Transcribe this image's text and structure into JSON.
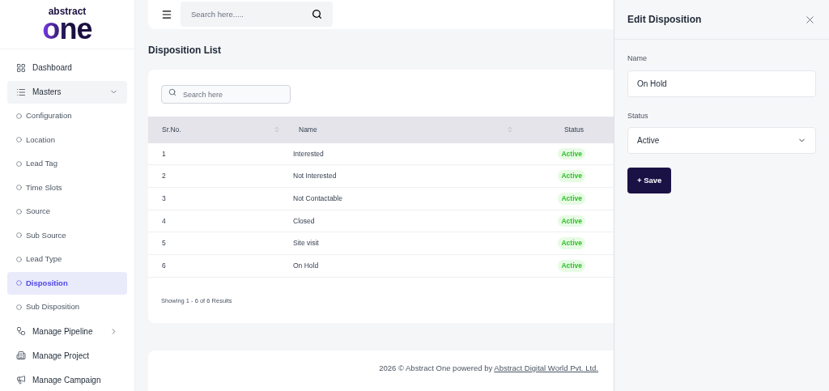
{
  "logo": {
    "top": "abstract",
    "word": "one"
  },
  "sidebar": {
    "items": [
      {
        "label": "Dashboard",
        "kind": "top",
        "selected": false
      },
      {
        "label": "Masters",
        "kind": "group",
        "expanded": true,
        "selected": false,
        "children": [
          {
            "label": "Configuration",
            "selected": false
          },
          {
            "label": "Location",
            "selected": false
          },
          {
            "label": "Lead Tag",
            "selected": false
          },
          {
            "label": "Time Slots",
            "selected": false
          },
          {
            "label": "Source",
            "selected": false
          },
          {
            "label": "Sub Source",
            "selected": false
          },
          {
            "label": "Lead Type",
            "selected": false
          },
          {
            "label": "Disposition",
            "selected": true
          },
          {
            "label": "Sub Disposition",
            "selected": false
          }
        ]
      },
      {
        "label": "Manage Pipeline",
        "kind": "group",
        "expanded": false,
        "selected": false
      },
      {
        "label": "Manage Project",
        "kind": "top",
        "selected": false
      },
      {
        "label": "Manage Campaign",
        "kind": "top",
        "selected": false
      }
    ]
  },
  "header": {
    "search": {
      "placeholder": "Search here....."
    }
  },
  "page_title": "Disposition List",
  "table": {
    "search": {
      "placeholder": "Search here"
    },
    "columns": [
      {
        "label": "Sr.No.",
        "sortable": true
      },
      {
        "label": "Name",
        "sortable": true
      },
      {
        "label": "Status",
        "sortable": false
      }
    ],
    "rows": [
      {
        "sr": "1",
        "name": "Interested",
        "status": "Active"
      },
      {
        "sr": "2",
        "name": "Not Interested",
        "status": "Active"
      },
      {
        "sr": "3",
        "name": "Not Contactable",
        "status": "Active"
      },
      {
        "sr": "4",
        "name": "Closed",
        "status": "Active"
      },
      {
        "sr": "5",
        "name": "Site visit",
        "status": "Active"
      },
      {
        "sr": "6",
        "name": "On Hold",
        "status": "Active"
      }
    ],
    "summary": "Showing 1 - 6 of 6 Results"
  },
  "footer": {
    "text": "2026 © Abstract One powered by",
    "link": "Abstract Digital World Pvt. Ltd."
  },
  "panel": {
    "title": "Edit Disposition",
    "fields": [
      {
        "label": "Name",
        "kind": "text",
        "value": "On Hold"
      },
      {
        "label": "Status",
        "kind": "select",
        "value": "Active"
      }
    ],
    "save_button": "+ Save"
  }
}
